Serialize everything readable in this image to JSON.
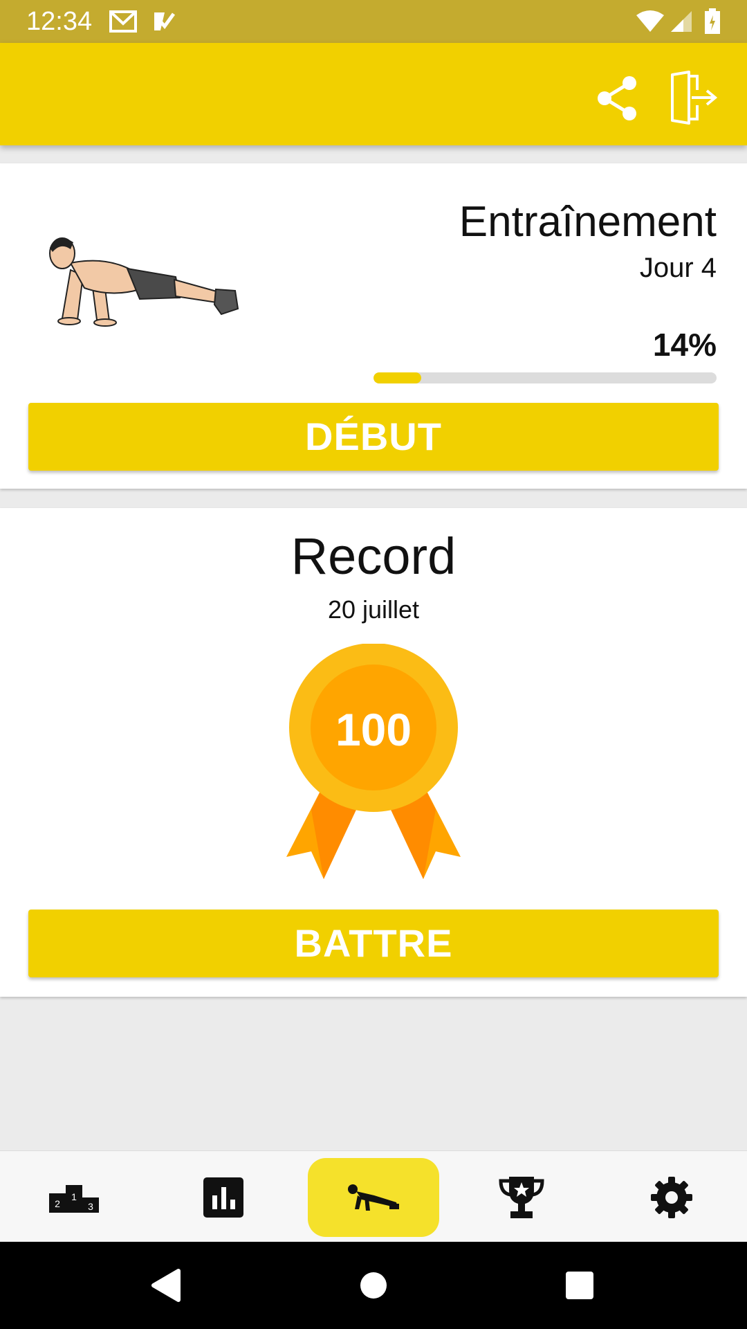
{
  "status_bar": {
    "time": "12:34",
    "icons": [
      "gmail-icon",
      "task-icon",
      "wifi-icon",
      "signal-icon",
      "battery-icon"
    ]
  },
  "app_bar": {
    "actions": [
      "share-icon",
      "exit-icon"
    ],
    "color": "#f1d000"
  },
  "training_card": {
    "title": "Entraînement",
    "day": "Jour 4",
    "progress_text": "14%",
    "progress": 0.14,
    "start_button": "DÉBUT",
    "illustration": "pushup-man-illustration"
  },
  "record_card": {
    "title": "Record",
    "date": "20 juillet",
    "value": "100",
    "beat_button": "BATTRE"
  },
  "bottom_nav": {
    "items": [
      {
        "icon": "podium-icon",
        "active": false
      },
      {
        "icon": "bar-chart-icon",
        "active": false
      },
      {
        "icon": "pushup-icon",
        "active": true
      },
      {
        "icon": "trophy-icon",
        "active": false
      },
      {
        "icon": "gear-icon",
        "active": false
      }
    ]
  },
  "system_nav": [
    "back-icon",
    "home-icon",
    "recents-icon"
  ],
  "colors": {
    "accent": "#f1d000",
    "status_bar": "#c4ab2f",
    "medal_outer": "#fbbc15",
    "medal_inner": "#ffa500",
    "ribbon": "#ff8c00"
  }
}
